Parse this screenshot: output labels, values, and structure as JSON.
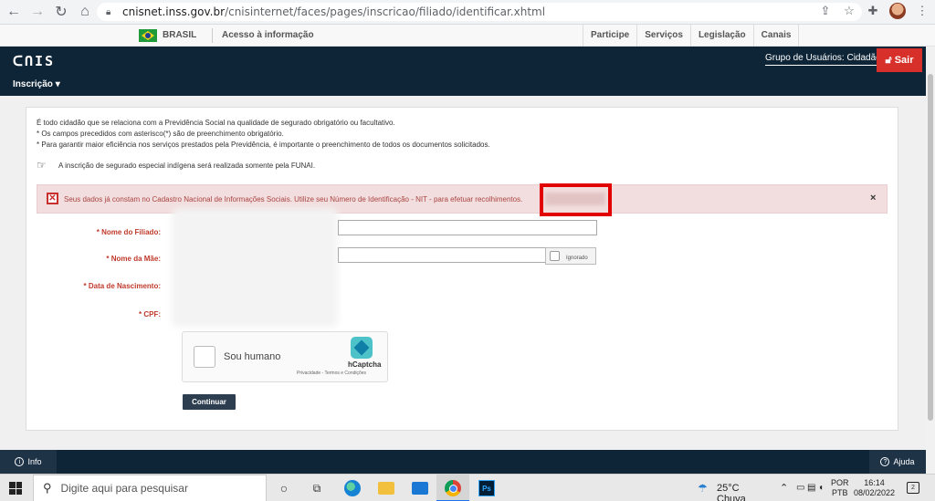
{
  "browser": {
    "url_host": "cnisnet.inss.gov.br",
    "url_path": "/cnisinternet/faces/pages/inscricao/filiado/identificar.xhtml"
  },
  "gov_bar": {
    "brasil": "BRASIL",
    "acesso": "Acesso à informação",
    "links": [
      "Participe",
      "Serviços",
      "Legislação",
      "Canais"
    ]
  },
  "header": {
    "logo": "CNIS",
    "menu": "Inscrição",
    "grupo": "Grupo de Usuários: Cidadão",
    "sair": "Sair"
  },
  "intro": {
    "line1": "É todo cidadão que se relaciona com a Previdência Social na qualidade de segurado obrigatório ou facultativo.",
    "line2": "* Os campos precedidos com asterisco(*) são de preenchimento obrigatório.",
    "line3": "* Para garantir maior eficiência nos serviços prestados pela Previdência, é importante o preenchimento de todos os documentos solicitados.",
    "funai": "A inscrição de segurado especial indígena será realizada somente pela FUNAI."
  },
  "error": {
    "message": "Seus dados já constam no Cadastro Nacional de Informações Sociais. Utilize seu Número de Identificação - NIT - para efetuar recolhimentos.",
    "close": "×"
  },
  "form": {
    "nome_filiado": "* Nome do Filiado:",
    "nome_mae": "* Nome da Mãe:",
    "ignorado": "Ignorado",
    "data_nascimento": "* Data de Nascimento:",
    "cpf": "* CPF:"
  },
  "captcha": {
    "label": "Sou humano",
    "brand": "hCaptcha",
    "links": "Privacidade - Termos e Condições"
  },
  "continuar": "Continuar",
  "footer": {
    "info": "Info",
    "ajuda": "Ajuda"
  },
  "taskbar": {
    "search_placeholder": "Digite aqui para pesquisar",
    "temp": "25°C  Chuva",
    "lang1": "POR",
    "lang2": "PTB",
    "time": "16:14",
    "date": "08/02/2022",
    "notifications": "2"
  }
}
